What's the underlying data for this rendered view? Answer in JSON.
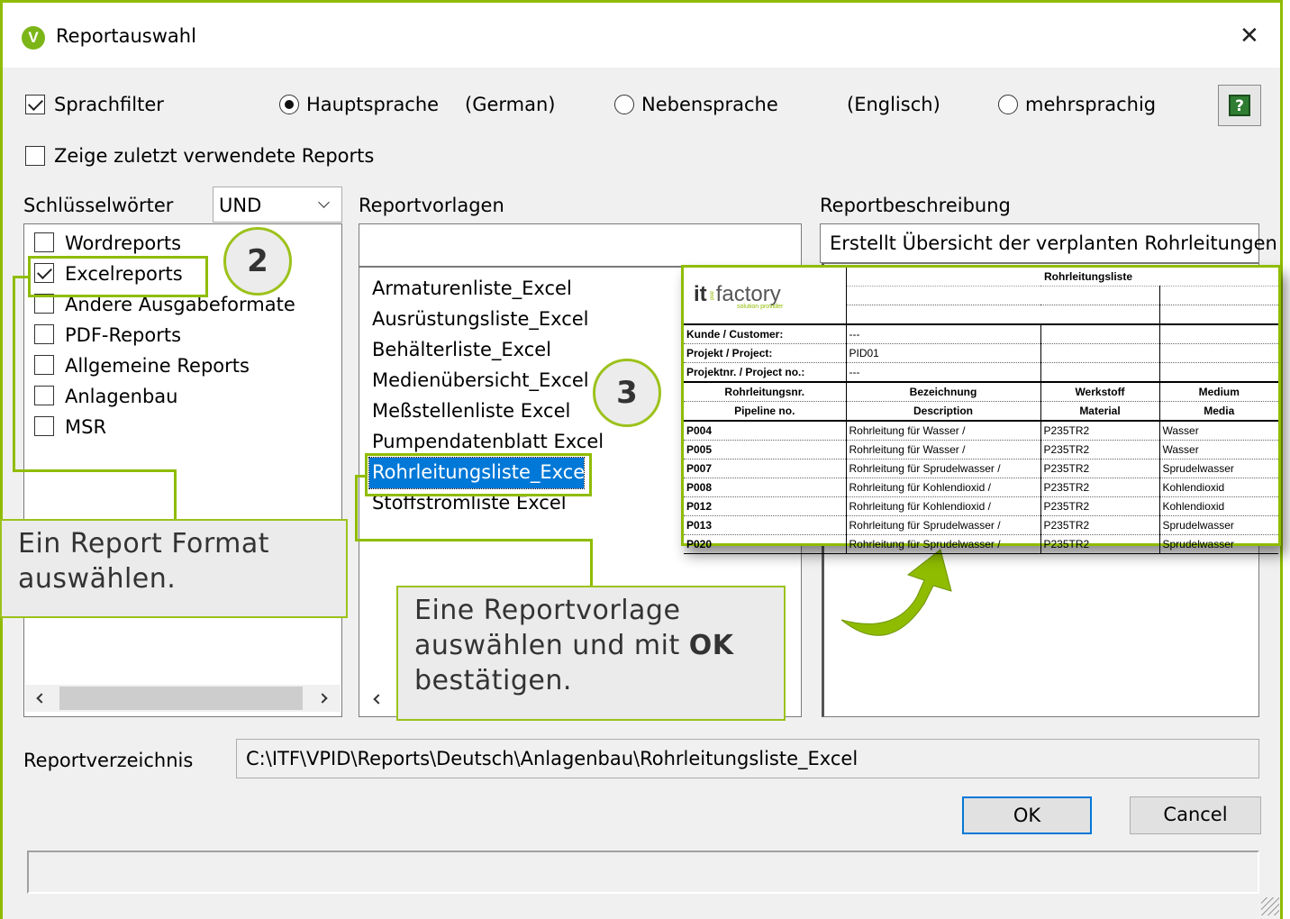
{
  "window": {
    "title": "Reportauswahl",
    "close": "✕"
  },
  "options": {
    "sprachfilter": "Sprachfilter",
    "hauptsprache": "Hauptsprache",
    "hauptsprache_value": "(German)",
    "nebensprache": "Nebensprache",
    "nebensprache_value": "(Englisch)",
    "mehrsprachig": "mehrsprachig",
    "zeige": "Zeige zuletzt verwendete Reports"
  },
  "keywords": {
    "label": "Schlüsselwörter",
    "operator": "UND",
    "items": [
      {
        "label": "Wordreports",
        "checked": false
      },
      {
        "label": "Excelreports",
        "checked": true
      },
      {
        "label": "Andere Ausgabeformate",
        "checked": false
      },
      {
        "label": "PDF-Reports",
        "checked": false
      },
      {
        "label": "Allgemeine Reports",
        "checked": false
      },
      {
        "label": "Anlagenbau",
        "checked": false
      },
      {
        "label": "MSR",
        "checked": false
      }
    ]
  },
  "templates": {
    "label": "Reportvorlagen",
    "search_value": "",
    "items": [
      "Armaturenliste_Excel",
      "Ausrüstungsliste_Excel",
      "Behälterliste_Excel",
      "Medienübersicht_Excel",
      "Meßstellenliste Excel",
      "Pumpendatenblatt Excel",
      "Rohrleitungsliste_Excel",
      "Stoffstromliste Excel"
    ],
    "selected": "Rohrleitungsliste_Excel"
  },
  "description": {
    "label": "Reportbeschreibung",
    "text": "Erstellt Übersicht der verplanten Rohrleitungen"
  },
  "directory": {
    "label": "Reportverzeichnis",
    "value": "C:\\ITF\\VPID\\Reports\\Deutsch\\Anlagenbau\\Rohrleitungsliste_Excel"
  },
  "buttons": {
    "ok": "OK",
    "cancel": "Cancel"
  },
  "callouts": {
    "step2": "2",
    "step3": "3",
    "format": "Ein Report Format auswählen.",
    "vorlage_pre": "Eine Reportvorlage auswählen und mit ",
    "vorlage_bold": "OK",
    "vorlage_post": " bestätigen."
  },
  "preview": {
    "logo_it": "it",
    "logo_and": "and",
    "logo_factory": "factory",
    "logo_sub": "solution provider",
    "title": "Rohrleitungsliste",
    "meta": [
      {
        "label": "Kunde / Customer:",
        "value": "---"
      },
      {
        "label": "Projekt / Project:",
        "value": "PID01"
      },
      {
        "label": "Projektnr. / Project no.:",
        "value": "---"
      }
    ],
    "headers_de": [
      "Rohrleitungsnr.",
      "Bezeichnung",
      "Werkstoff",
      "Medium"
    ],
    "headers_en": [
      "Pipeline no.",
      "Description",
      "Material",
      "Media"
    ],
    "rows": [
      [
        "P004",
        "Rohrleitung für Wasser /",
        "P235TR2",
        "Wasser"
      ],
      [
        "P005",
        "Rohrleitung für Wasser /",
        "P235TR2",
        "Wasser"
      ],
      [
        "P007",
        "Rohrleitung für Sprudelwasser /",
        "P235TR2",
        "Sprudelwasser"
      ],
      [
        "P008",
        "Rohrleitung für Kohlendioxid /",
        "P235TR2",
        "Kohlendioxid"
      ],
      [
        "P012",
        "Rohrleitung für Kohlendioxid /",
        "P235TR2",
        "Kohlendioxid"
      ],
      [
        "P013",
        "Rohrleitung für Sprudelwasser /",
        "P235TR2",
        "Sprudelwasser"
      ],
      [
        "P020",
        "Rohrleitung für Sprudelwasser /",
        "P235TR2",
        "Sprudelwasser"
      ]
    ]
  },
  "colors": {
    "accent": "#8fbc00",
    "selection": "#0078d7"
  }
}
